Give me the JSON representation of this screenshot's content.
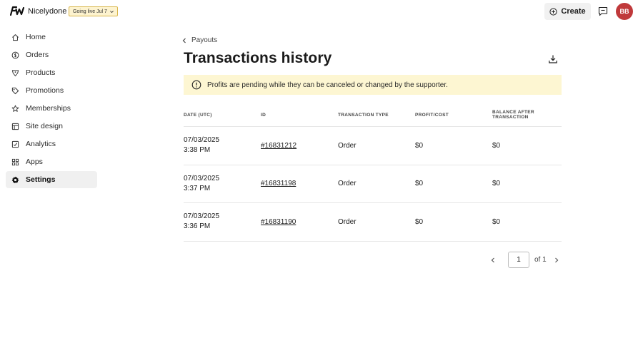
{
  "header": {
    "brand": "Nicelydone",
    "live_badge": "Going live Jul 7",
    "create_label": "Create",
    "avatar_initials": "BB",
    "avatar_color": "#c0393b"
  },
  "sidebar": {
    "items": [
      {
        "label": "Home",
        "icon": "home-icon"
      },
      {
        "label": "Orders",
        "icon": "dollar-circle-icon"
      },
      {
        "label": "Products",
        "icon": "tag-icon"
      },
      {
        "label": "Promotions",
        "icon": "percent-tag-icon"
      },
      {
        "label": "Memberships",
        "icon": "star-icon"
      },
      {
        "label": "Site design",
        "icon": "layout-icon"
      },
      {
        "label": "Analytics",
        "icon": "chart-check-icon"
      },
      {
        "label": "Apps",
        "icon": "grid-icon"
      },
      {
        "label": "Settings",
        "icon": "gear-icon",
        "active": true
      }
    ]
  },
  "main": {
    "back_label": "Payouts",
    "title": "Transactions history",
    "notice": "Profits are pending while they can be canceled or changed by the supporter.",
    "notice_color": "#fdf6d2"
  },
  "table": {
    "headers": [
      "Date (UTC)",
      "ID",
      "Transaction type",
      "Profit/Cost",
      "Balance after transaction"
    ],
    "rows": [
      {
        "date": "07/03/2025",
        "time": "3:38 PM",
        "id": "#16831212",
        "type": "Order",
        "profit": "$0",
        "balance": "$0"
      },
      {
        "date": "07/03/2025",
        "time": "3:37 PM",
        "id": "#16831198",
        "type": "Order",
        "profit": "$0",
        "balance": "$0"
      },
      {
        "date": "07/03/2025",
        "time": "3:36 PM",
        "id": "#16831190",
        "type": "Order",
        "profit": "$0",
        "balance": "$0"
      }
    ]
  },
  "pagination": {
    "current_page": "1",
    "of_label": "of 1"
  }
}
